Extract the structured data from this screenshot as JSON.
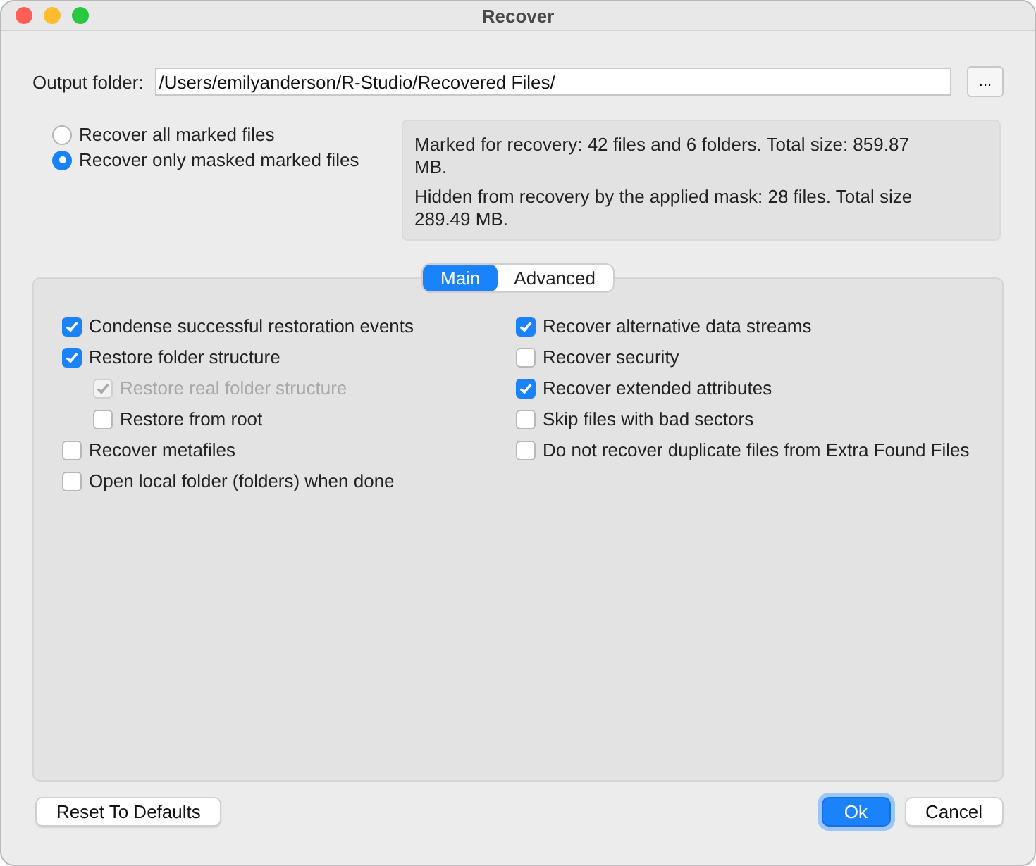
{
  "window": {
    "title": "Recover"
  },
  "output_folder": {
    "label": "Output folder:",
    "value": "/Users/emilyanderson/R-Studio/Recovered Files/",
    "browse_label": "..."
  },
  "scope_options": [
    {
      "label": "Recover all marked files",
      "selected": false
    },
    {
      "label": "Recover only masked marked files",
      "selected": true
    }
  ],
  "summary": [
    "Marked for recovery: 42 files and 6 folders. Total size: 859.87 MB.",
    "Hidden from recovery by the applied mask: 28 files. Total size 289.49 MB."
  ],
  "tabs": [
    {
      "label": "Main",
      "selected": true
    },
    {
      "label": "Advanced",
      "selected": false
    }
  ],
  "left_options": [
    {
      "label": "Condense successful restoration events",
      "checked": true,
      "disabled": false
    },
    {
      "label": "Restore folder structure",
      "checked": true,
      "disabled": false,
      "children": [
        {
          "label": "Restore real folder structure",
          "checked": true,
          "disabled": true
        },
        {
          "label": "Restore from root",
          "checked": false,
          "disabled": false
        }
      ]
    },
    {
      "label": "Recover metafiles",
      "checked": false,
      "disabled": false
    },
    {
      "label": "Open local folder (folders) when done",
      "checked": false,
      "disabled": false
    }
  ],
  "right_options": [
    {
      "label": "Recover alternative data streams",
      "checked": true,
      "disabled": false
    },
    {
      "label": "Recover security",
      "checked": false,
      "disabled": false
    },
    {
      "label": "Recover extended attributes",
      "checked": true,
      "disabled": false
    },
    {
      "label": "Skip files with bad sectors",
      "checked": false,
      "disabled": false
    },
    {
      "label": "Do not recover duplicate files from Extra Found Files",
      "checked": false,
      "disabled": false
    }
  ],
  "buttons_left": [
    {
      "label": "Reset To Defaults",
      "default": false
    }
  ],
  "buttons_right": [
    {
      "label": "Ok",
      "default": true
    },
    {
      "label": "Cancel",
      "default": false
    }
  ]
}
